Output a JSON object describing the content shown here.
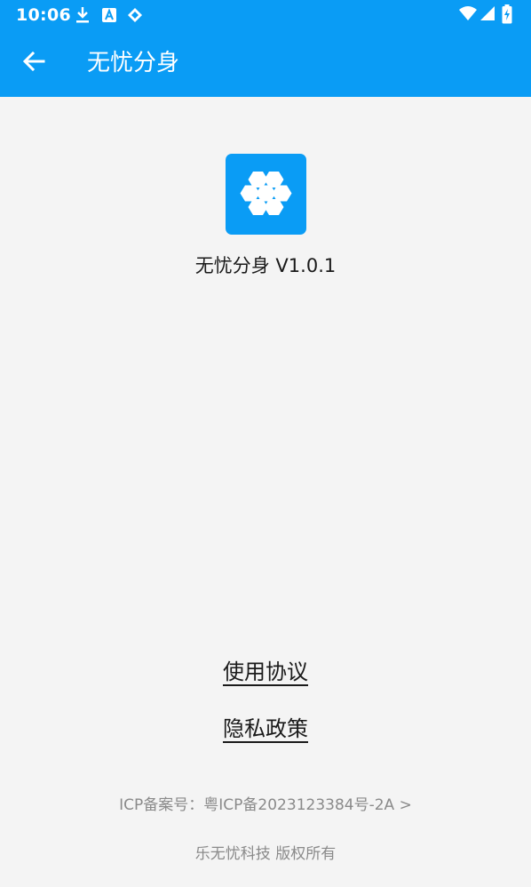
{
  "status_bar": {
    "time": "10:06",
    "left_icons": [
      "download-icon",
      "a-icon",
      "diamond-icon"
    ],
    "right_icons": [
      "wifi-icon",
      "signal-icon",
      "battery-charging-icon"
    ]
  },
  "app_bar": {
    "title": "无忧分身",
    "back_icon": "arrow-left-icon"
  },
  "colors": {
    "primary": "#0a9cf5",
    "background": "#f4f4f4",
    "footer_text": "#8a8a8a"
  },
  "about": {
    "logo_icon": "hexagon-cluster-icon",
    "version_text": "无忧分身 V1.0.1"
  },
  "links": {
    "terms": "使用协议",
    "privacy": "隐私政策"
  },
  "footer": {
    "icp": "ICP备案号：粤ICP备2023123384号-2A >",
    "copyright": "乐无忧科技 版权所有"
  }
}
